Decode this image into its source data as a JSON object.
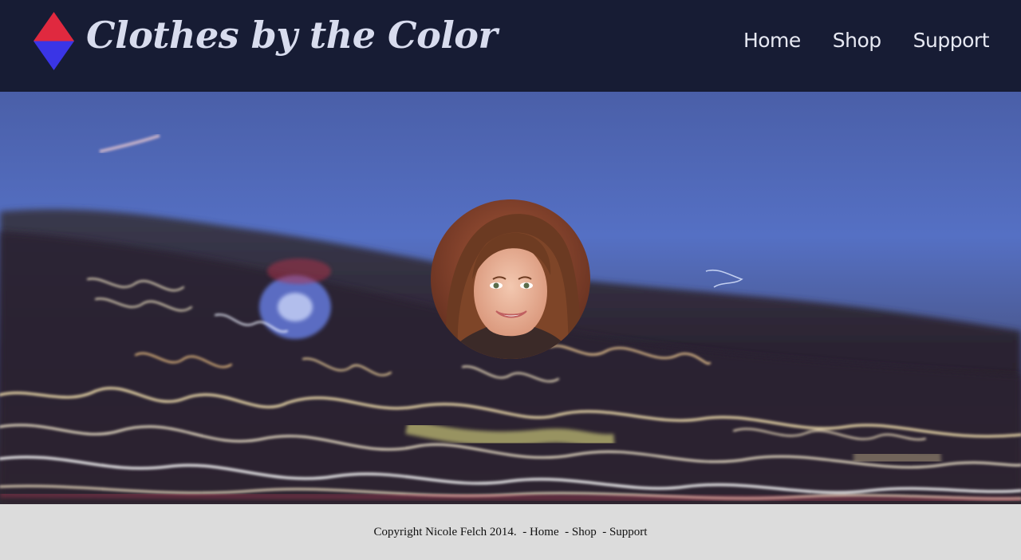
{
  "header": {
    "title": "Clothes by the Color",
    "logo_icon": "diamond-logo-icon",
    "nav": {
      "home": "Home",
      "shop": "Shop",
      "support": "Support"
    }
  },
  "colors": {
    "header_bg": "#171c34",
    "logo_top": "#e0293f",
    "logo_bottom": "#3a35e6",
    "footer_bg": "#dcdcdc"
  },
  "hero": {
    "image": "night-long-exposure-light-trails",
    "avatar": "profile-photo-avatar"
  },
  "footer": {
    "copyright": "Copyright Nicole Felch 2014.",
    "separator": "  - ",
    "links": {
      "home": "Home",
      "shop": "Shop",
      "support": "Support"
    }
  }
}
